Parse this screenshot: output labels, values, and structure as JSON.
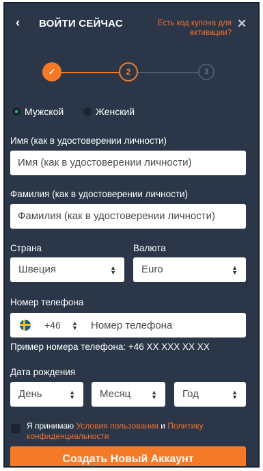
{
  "header": {
    "back_icon": "chevron-left-icon",
    "title": "ВОЙТИ СЕЙЧАС",
    "coupon_link": "Есть код купона для активации?",
    "close_icon": "close-icon"
  },
  "steps": {
    "step1": "✓",
    "step2": "2",
    "step3": "3",
    "active_color": "#f47a27",
    "inactive_color": "#4c5a6d"
  },
  "gender": {
    "male_label": "Мужской",
    "female_label": "Женский",
    "selected": "Мужской"
  },
  "first_name": {
    "label": "Имя (как в удостоверении личности)",
    "placeholder": "Имя (как в удостоверении личности)"
  },
  "last_name": {
    "label": "Фамилия (как в удостоверении личности)",
    "placeholder": "Фамилия (как в удостоверении личности)"
  },
  "country": {
    "label": "Страна",
    "value": "Швеция"
  },
  "currency": {
    "label": "Валюта",
    "value": "Euro"
  },
  "phone": {
    "label": "Номер телефона",
    "flag_icon": "sweden-flag-icon",
    "code": "+46",
    "placeholder": "Номер телефона",
    "example": "Пример номера телефона: +46 XX XXX XX XX"
  },
  "birthdate": {
    "label": "Дата рождения",
    "day": "День",
    "month": "Месяц",
    "year": "Год"
  },
  "terms": {
    "prefix": "Я принимаю ",
    "terms_link": "Условия пользования",
    "and": " и ",
    "privacy_link": "Политику конфиденциальности"
  },
  "submit_label": "Создать Новый Аккаунт",
  "colors": {
    "background": "#2b3748",
    "accent": "#f47a27",
    "link": "#f36d2a"
  }
}
